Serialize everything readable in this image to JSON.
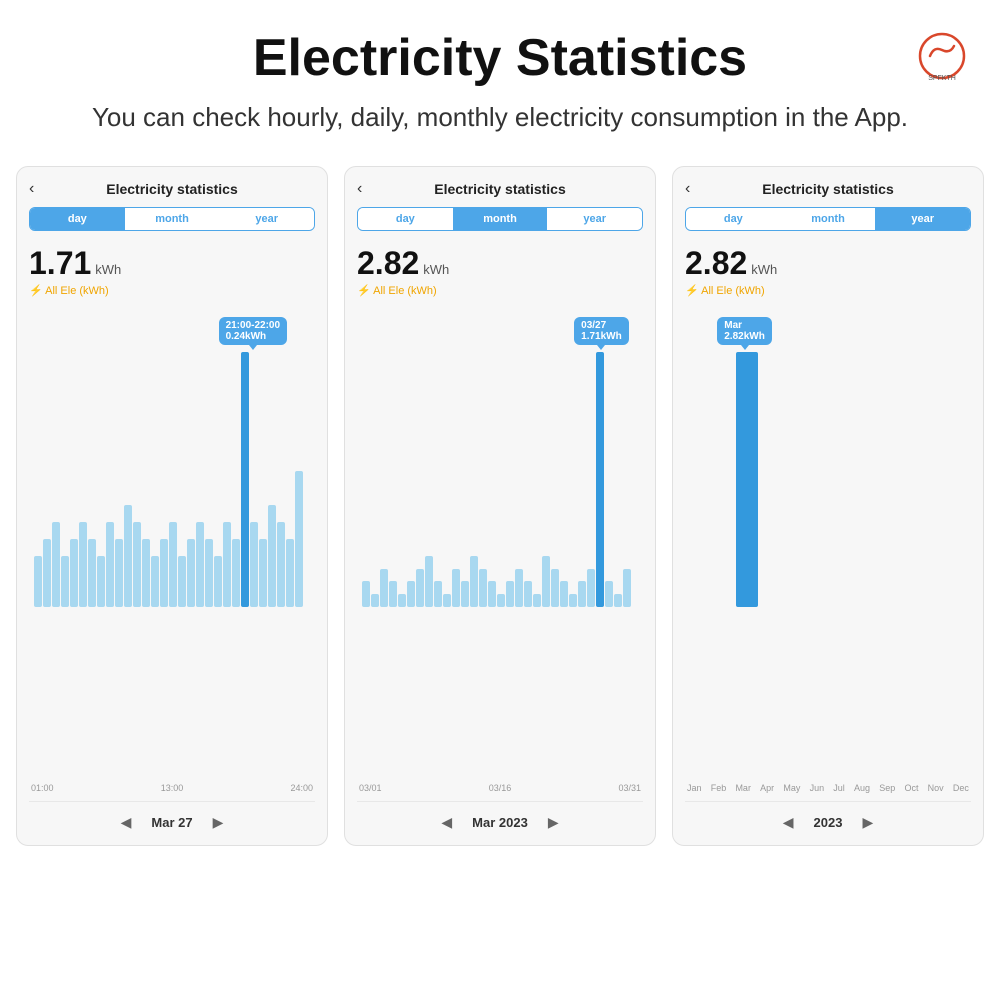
{
  "header": {
    "title": "Electricity Statistics",
    "subtitle": "You can check hourly, daily, monthly electricity consumption in the App."
  },
  "logo": {
    "alt": "SPFKTH logo"
  },
  "screens": [
    {
      "id": "day-screen",
      "title": "Electricity statistics",
      "tabs": [
        {
          "label": "day",
          "active": true
        },
        {
          "label": "month",
          "active": false
        },
        {
          "label": "year",
          "active": false
        }
      ],
      "stat_number": "1.71",
      "stat_unit": "kWh",
      "stat_label": "⚡ All Ele (kWh)",
      "tooltip_line1": "21:00-22:00",
      "tooltip_line2": "0.24kWh",
      "x_labels": [
        "01:00",
        "13:00",
        "24:00"
      ],
      "nav_label": "Mar 27",
      "bar_data": [
        3,
        4,
        5,
        3,
        4,
        5,
        4,
        3,
        5,
        4,
        6,
        5,
        4,
        3,
        4,
        5,
        3,
        4,
        5,
        4,
        3,
        5,
        4,
        15,
        5,
        4,
        6,
        5,
        4,
        8
      ],
      "highlighted_bar": 23
    },
    {
      "id": "month-screen",
      "title": "Electricity statistics",
      "tabs": [
        {
          "label": "day",
          "active": false
        },
        {
          "label": "month",
          "active": true
        },
        {
          "label": "year",
          "active": false
        }
      ],
      "stat_number": "2.82",
      "stat_unit": "kWh",
      "stat_label": "⚡ All Ele (kWh)",
      "tooltip_line1": "03/27",
      "tooltip_line2": "1.71kWh",
      "x_labels": [
        "03/01",
        "03/16",
        "03/31"
      ],
      "nav_label": "Mar 2023",
      "bar_data": [
        2,
        1,
        3,
        2,
        1,
        2,
        3,
        4,
        2,
        1,
        3,
        2,
        4,
        3,
        2,
        1,
        2,
        3,
        2,
        1,
        4,
        3,
        2,
        1,
        2,
        3,
        20,
        2,
        1,
        3
      ],
      "highlighted_bar": 26
    },
    {
      "id": "year-screen",
      "title": "Electricity statistics",
      "tabs": [
        {
          "label": "day",
          "active": false
        },
        {
          "label": "month",
          "active": false
        },
        {
          "label": "year",
          "active": true
        }
      ],
      "stat_number": "2.82",
      "stat_unit": "kWh",
      "stat_label": "⚡ All Ele (kWh)",
      "tooltip_line1": "Mar",
      "tooltip_line2": "2.82kWh",
      "x_labels": [
        "Jan",
        "Feb",
        "Mar",
        "Apr",
        "May",
        "Jun",
        "Jul",
        "Aug",
        "Sep",
        "Oct",
        "Nov",
        "Dec"
      ],
      "nav_label": "2023",
      "bar_data": [
        0,
        0,
        25,
        0,
        0,
        0,
        0,
        0,
        0,
        0,
        0,
        0
      ],
      "highlighted_bar": 2
    }
  ]
}
